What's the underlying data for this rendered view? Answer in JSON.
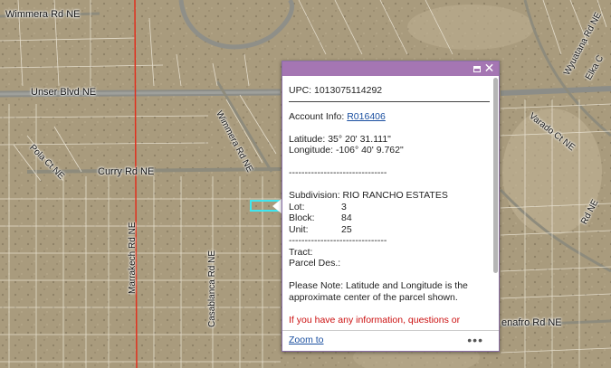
{
  "map": {
    "streets": [
      {
        "name": "wimmera-rd-ne-top-label",
        "text": "Wimmera Rd NE"
      },
      {
        "name": "unser-blvd-ne-label",
        "text": "Unser Blvd NE"
      },
      {
        "name": "wimmera-rd-ne-diagonal-label",
        "text": "Wimmera Rd NE"
      },
      {
        "name": "pola-ct-ne-label",
        "text": "Pola Ct NE"
      },
      {
        "name": "curry-rd-ne-label",
        "text": "Curry Rd NE"
      },
      {
        "name": "marrakech-rd-ne-label",
        "text": "Marrakech Rd NE"
      },
      {
        "name": "casablanca-rd-ne-label",
        "text": "Casablanca Rd NE"
      },
      {
        "name": "wyuatana-rd-ne-label",
        "text": "Wyuatana Rd NE"
      },
      {
        "name": "elka-ct-label",
        "text": "Elka C"
      },
      {
        "name": "varado-ct-ne-label",
        "text": "Varado Ct NE"
      },
      {
        "name": "rd-ne-right-label",
        "text": "Rd NE"
      },
      {
        "name": "enafro-rd-ne-label",
        "text": "enafro Rd NE"
      }
    ]
  },
  "popup": {
    "upc": "UPC: 1013075114292",
    "account_label": "Account Info: ",
    "account_value": "R016406",
    "latitude": "Latitude: 35° 20' 31.111\"",
    "longitude": "Longitude: -106° 40' 9.762\"",
    "separator": "-------------------------------",
    "subdivision": "Subdivision: RIO RANCHO ESTATES",
    "lot_label": "Lot:",
    "lot_value": "3",
    "block_label": "Block:",
    "block_value": "84",
    "unit_label": "Unit:",
    "unit_value": "25",
    "separator2": "-------------------------------",
    "tract": "Tract:",
    "parcel_des": "Parcel Des.:",
    "note": "Please Note: Latitude and Longitude is the approximate center of the parcel shown.",
    "info_line": "If you have any information, questions or",
    "zoom_to": "Zoom to",
    "more": "•••",
    "maximize_icon": "maximize-icon",
    "close_icon": "close-icon",
    "header_color": "#a576b3"
  }
}
